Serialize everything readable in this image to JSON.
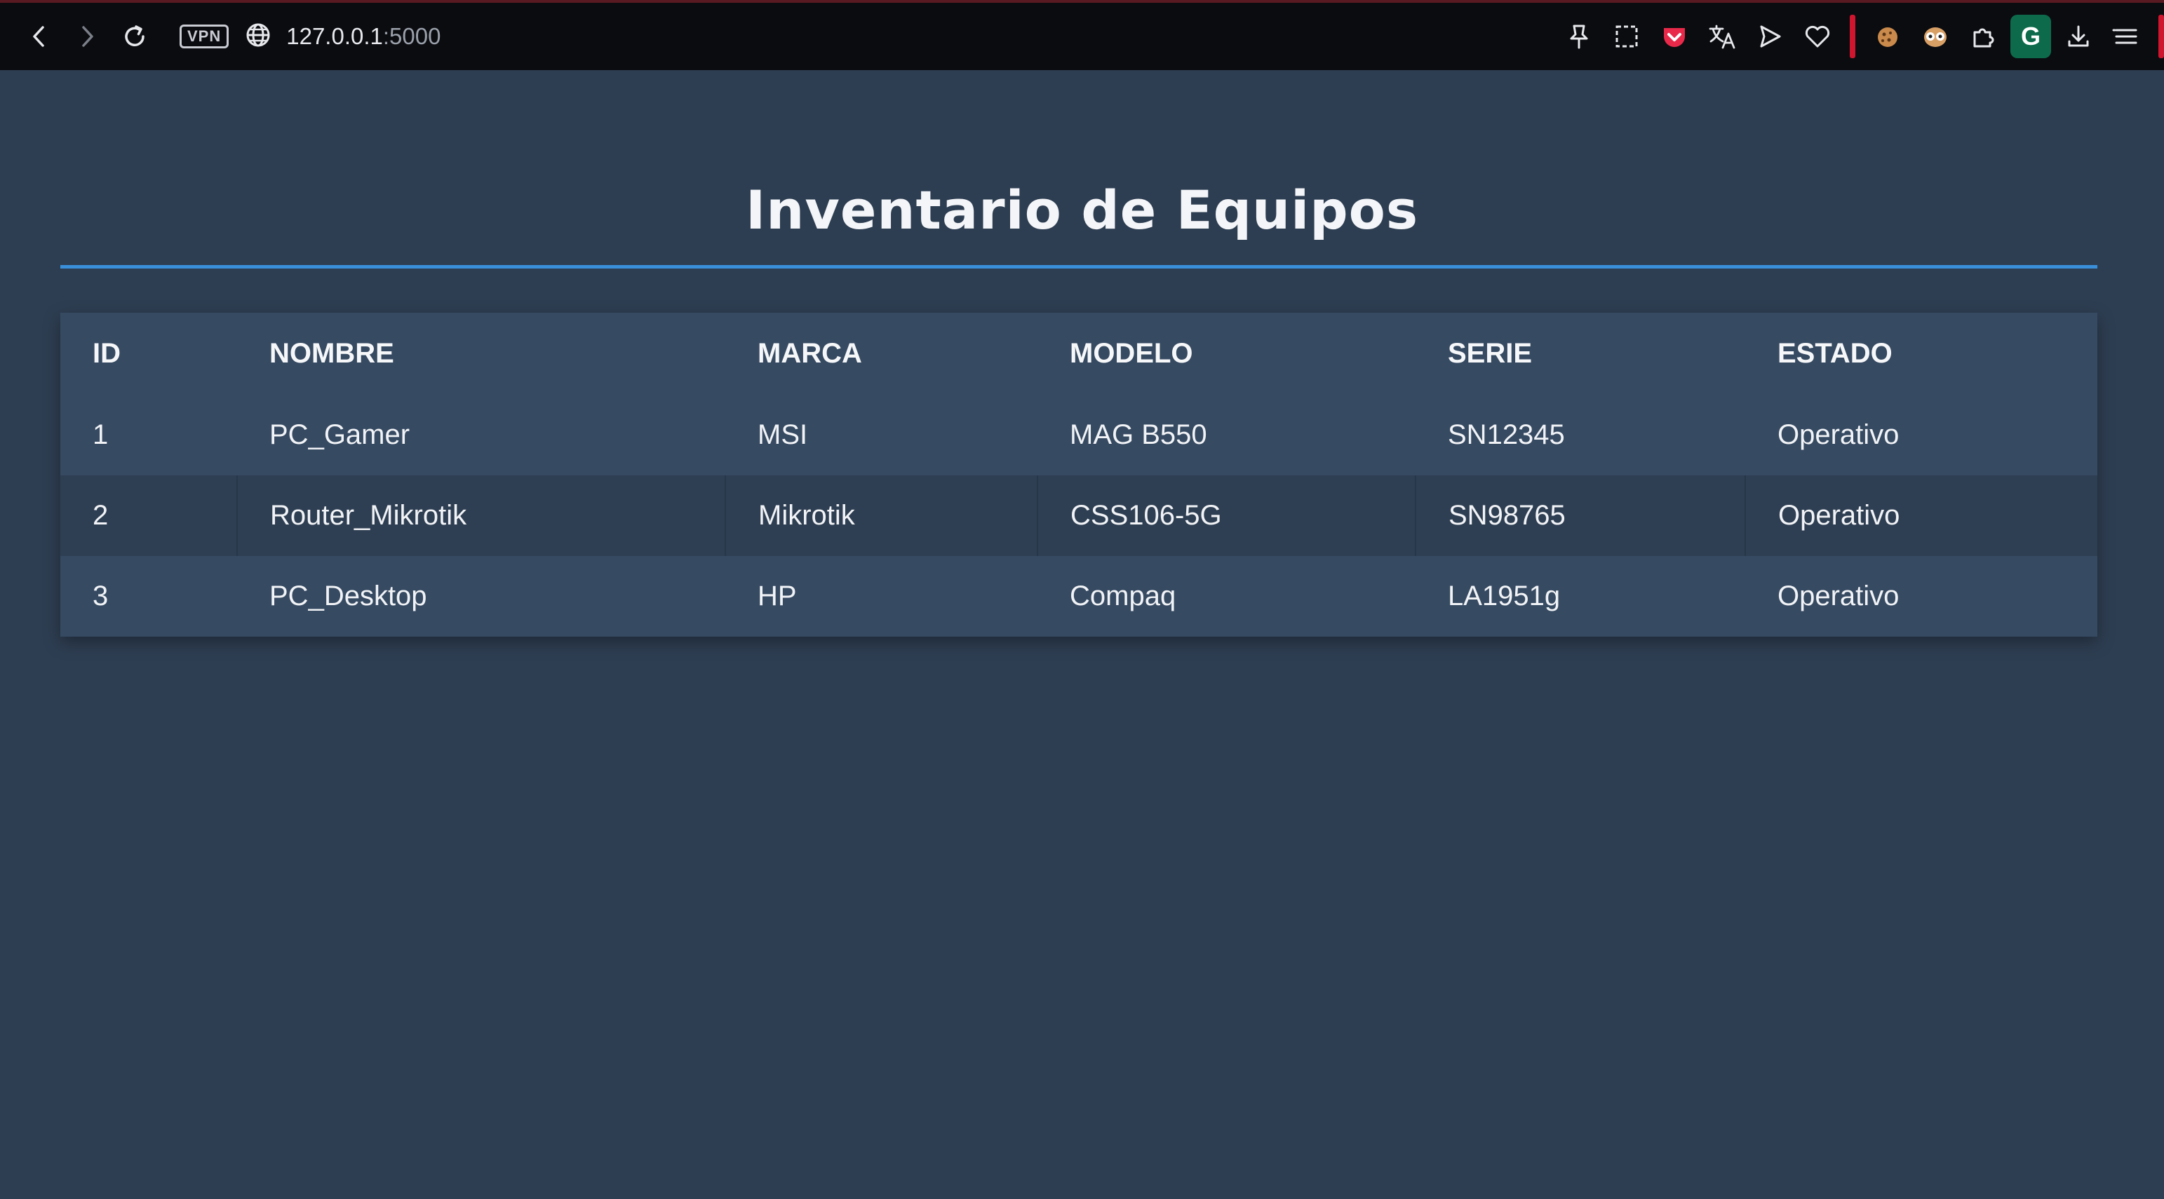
{
  "browser": {
    "vpn_label": "VPN",
    "url_host": "127.0.0.1",
    "url_port": ":5000",
    "profile_initial": "G",
    "icons": {
      "back": "back-arrow-icon",
      "forward": "forward-arrow-icon",
      "reload": "reload-icon",
      "site_info": "globe-icon"
    }
  },
  "page": {
    "title": "Inventario de Equipos"
  },
  "table": {
    "headers": {
      "id": "ID",
      "nombre": "NOMBRE",
      "marca": "MARCA",
      "modelo": "MODELO",
      "serie": "SERIE",
      "estado": "ESTADO"
    },
    "rows": [
      {
        "id": "1",
        "nombre": "PC_Gamer",
        "marca": "MSI",
        "modelo": "MAG B550",
        "serie": "SN12345",
        "estado": "Operativo"
      },
      {
        "id": "2",
        "nombre": "Router_Mikrotik",
        "marca": "Mikrotik",
        "modelo": "CSS106-5G",
        "serie": "SN98765",
        "estado": "Operativo"
      },
      {
        "id": "3",
        "nombre": "PC_Desktop",
        "marca": "HP",
        "modelo": "Compaq",
        "serie": "LA1951g",
        "estado": "Operativo"
      }
    ]
  },
  "colors": {
    "background": "#2e3e52",
    "accent_rule": "#3a8fdb",
    "row_light": "#364a62",
    "row_dark": "#2f3f53"
  }
}
